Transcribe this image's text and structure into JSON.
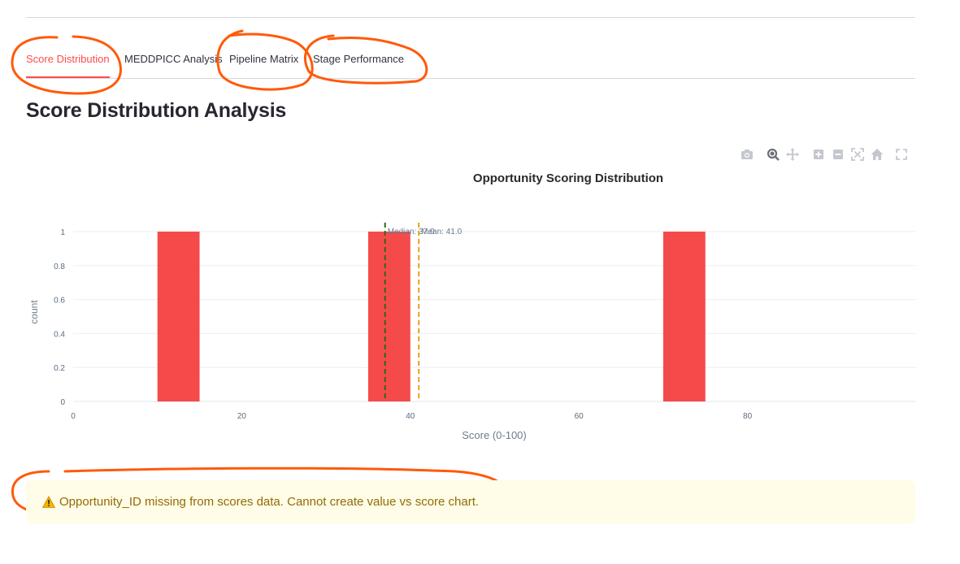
{
  "tabs": [
    {
      "label": "Score Distribution",
      "active": true
    },
    {
      "label": "MEDDPICC Analysis",
      "active": false
    },
    {
      "label": "Pipeline Matrix",
      "active": false
    },
    {
      "label": "Stage Performance",
      "active": false
    }
  ],
  "page_title": "Score Distribution Analysis",
  "modebar": [
    "camera-icon",
    "zoom-icon",
    "pan-icon",
    "zoom-in-icon",
    "zoom-out-icon",
    "autoscale-icon",
    "reset-axes-icon",
    "fullscreen-icon"
  ],
  "chart_data": {
    "type": "bar",
    "title": "Opportunity Scoring Distribution",
    "xlabel": "Score (0-100)",
    "ylabel": "count",
    "xlim": [
      0,
      100
    ],
    "ylim": [
      0,
      1
    ],
    "x_ticks": [
      "0",
      "20",
      "40",
      "60",
      "80"
    ],
    "y_ticks": [
      "0",
      "0.2",
      "0.4",
      "0.6",
      "0.8",
      "1"
    ],
    "bins": [
      {
        "start": 10,
        "end": 15,
        "count": 1
      },
      {
        "start": 35,
        "end": 40,
        "count": 1
      },
      {
        "start": 70,
        "end": 75,
        "count": 1
      }
    ],
    "bar_color": "#f54a4a",
    "grid": true,
    "reference_lines": [
      {
        "label": "Median: 37.0",
        "x": 37,
        "color": "#2a6b12"
      },
      {
        "label": "Mean: 41.0",
        "x": 41,
        "color": "#e8a21c"
      }
    ]
  },
  "alert": {
    "icon": "warning-icon",
    "text": "Opportunity_ID missing from scores data. Cannot create value vs score chart."
  },
  "colors": {
    "accent": "#ff4b4b",
    "annotation": "#ff5a0a",
    "alert_bg": "#fffce7",
    "alert_text": "#926c05"
  }
}
